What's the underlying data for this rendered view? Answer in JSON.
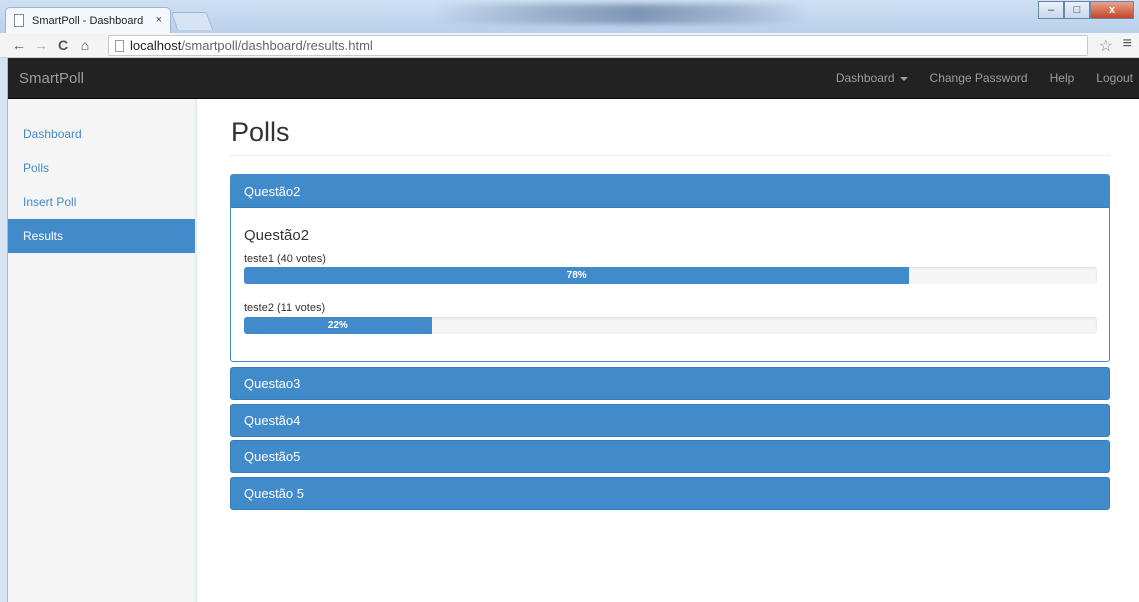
{
  "browser": {
    "tab_title": "SmartPoll - Dashboard",
    "tab_close": "×",
    "address_host": "localhost",
    "address_path": "/smartpoll/dashboard/results.html",
    "window_buttons": {
      "minimize": "–",
      "maximize": "□",
      "close": "x"
    }
  },
  "navbar": {
    "brand": "SmartPoll",
    "items": [
      "Dashboard",
      "Change Password",
      "Help",
      "Logout"
    ]
  },
  "sidebar": {
    "items": [
      {
        "label": "Dashboard",
        "active": false
      },
      {
        "label": "Polls",
        "active": false
      },
      {
        "label": "Insert Poll",
        "active": false
      },
      {
        "label": "Results",
        "active": true
      }
    ]
  },
  "main": {
    "title": "Polls",
    "open_panel": {
      "header": "Questão2",
      "question": "Questão2",
      "options": [
        {
          "label": "teste1 (40 votes)",
          "percent": 78,
          "percent_label": "78%"
        },
        {
          "label": "teste2 (11 votes)",
          "percent": 22,
          "percent_label": "22%"
        }
      ]
    },
    "collapsed_panels": [
      "Questao3",
      "Questão4",
      "Questão5",
      "Questão 5"
    ]
  },
  "colors": {
    "primary": "#428bca",
    "navbar": "#222222"
  }
}
